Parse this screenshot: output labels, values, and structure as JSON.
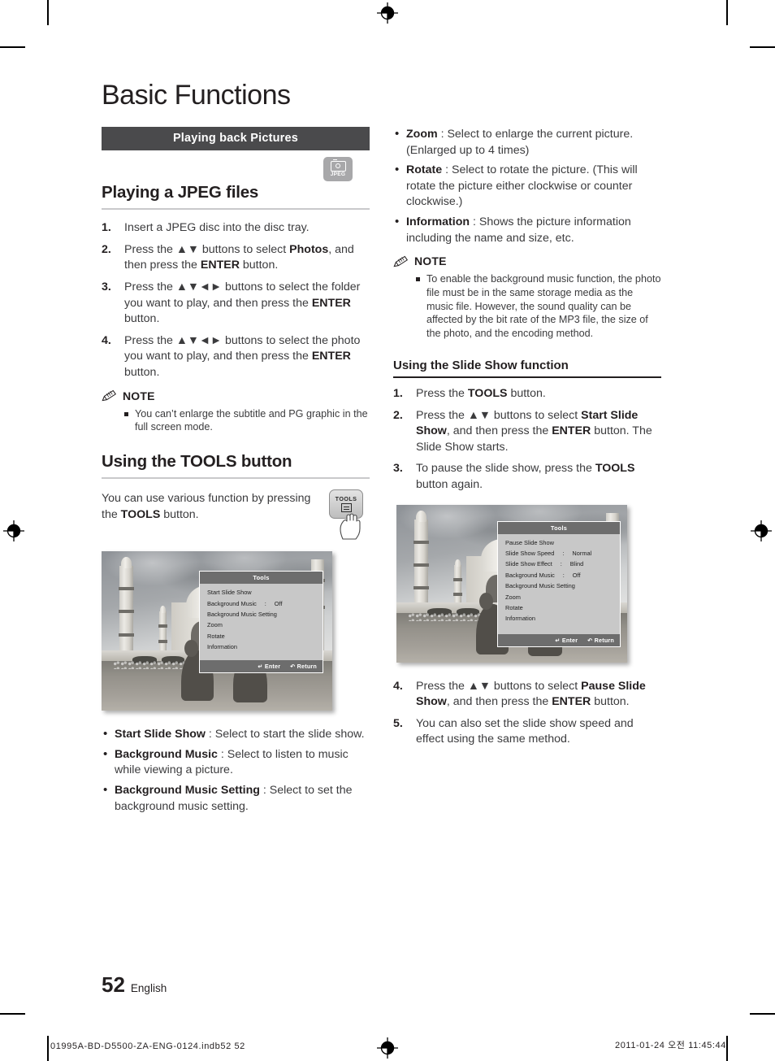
{
  "chapter": {
    "title": "Basic Functions"
  },
  "section_banner": {
    "label": "Playing back Pictures"
  },
  "media_badge": {
    "icon": "camera-icon",
    "label": "JPEG"
  },
  "left": {
    "heading": "Playing a JPEG files",
    "steps": [
      {
        "num": "1.",
        "text": "Insert a JPEG disc into the disc tray."
      },
      {
        "num": "2.",
        "text": "Press the ▲▼ buttons to select <b>Photos</b>, and then press the <b>ENTER</b> button."
      },
      {
        "num": "3.",
        "text": "Press the ▲▼◄► buttons to select the folder you want to play, and then press the <b>ENTER</b> button."
      },
      {
        "num": "4.",
        "text": "Press the ▲▼◄► buttons to select the photo you want to play, and then press the <b>ENTER</b> button."
      }
    ],
    "note": {
      "label": "NOTE",
      "items": [
        "You can’t enlarge the subtitle and PG graphic in the full screen mode."
      ]
    },
    "tools_heading": "Using the TOOLS button",
    "tools_paragraph": "You can use various function by pressing the <b>TOOLS</b> button.",
    "tools_key": {
      "label": "TOOLS",
      "icon": "tools-key-icon",
      "hand": "pointing-hand-icon"
    },
    "bullets": [
      {
        "term": "Start Slide Show",
        "desc": " : Select to start the slide show."
      },
      {
        "term": "Background Music",
        "desc": " : Select to listen to music while viewing a picture."
      },
      {
        "term": "Background Music Setting",
        "desc": " : Select to set the background music setting."
      }
    ]
  },
  "right": {
    "bullets": [
      {
        "term": "Zoom",
        "desc": " : Select to enlarge the current picture. (Enlarged up to 4 times)"
      },
      {
        "term": "Rotate",
        "desc": " : Select to rotate the picture. (This will rotate the picture either clockwise or counter clockwise.)"
      },
      {
        "term": "Information",
        "desc": " : Shows the picture information including the name and size, etc."
      }
    ],
    "note": {
      "label": "NOTE",
      "items": [
        "To enable the background music function, the photo file must be in the same storage media as the music file. However, the sound quality can be affected by the bit rate of the MP3 file, the size of the photo, and the encoding method."
      ]
    },
    "subheading": "Using the Slide Show function",
    "steps_top": [
      {
        "num": "1.",
        "text": "Press the <b>TOOLS</b> button."
      },
      {
        "num": "2.",
        "text": "Press the ▲▼ buttons to select <b>Start Slide Show</b>, and then press the <b>ENTER</b> button. The Slide Show starts."
      },
      {
        "num": "3.",
        "text": "To pause the slide show, press the <b>TOOLS</b> button again."
      }
    ],
    "steps_bottom": [
      {
        "num": "4.",
        "text": "Press the ▲▼ buttons to select <b>Pause Slide Show</b>, and then press the <b>ENTER</b> button."
      },
      {
        "num": "5.",
        "text": "You can also set the slide show speed and effect using the same method."
      }
    ]
  },
  "osd_left": {
    "title": "Tools",
    "items": [
      {
        "key": "Start Slide Show",
        "colon": "",
        "value": ""
      },
      {
        "key": "Background Music",
        "colon": ":",
        "value": "Off"
      },
      {
        "key": "Background Music Setting",
        "colon": "",
        "value": ""
      },
      {
        "key": "Zoom",
        "colon": "",
        "value": ""
      },
      {
        "key": "Rotate",
        "colon": "",
        "value": ""
      },
      {
        "key": "Information",
        "colon": "",
        "value": ""
      }
    ],
    "footer": {
      "enter": "Enter",
      "return": "Return"
    }
  },
  "osd_right": {
    "title": "Tools",
    "items": [
      {
        "key": "Pause Slide Show",
        "colon": "",
        "value": ""
      },
      {
        "key": "Slide Show Speed",
        "colon": ":",
        "value": "Normal"
      },
      {
        "key": "Slide Show Effect",
        "colon": ":",
        "value": "Blind"
      },
      {
        "key": "Background Music",
        "colon": ":",
        "value": "Off"
      },
      {
        "key": "Background Music Setting",
        "colon": "",
        "value": ""
      },
      {
        "key": "Zoom",
        "colon": "",
        "value": ""
      },
      {
        "key": "Rotate",
        "colon": "",
        "value": ""
      },
      {
        "key": "Information",
        "colon": "",
        "value": ""
      }
    ],
    "footer": {
      "enter": "Enter",
      "return": "Return"
    }
  },
  "footer": {
    "page_number": "52",
    "language": "English",
    "imprint_left": "01995A-BD-D5500-ZA-ENG-0124.indb52   52",
    "imprint_right": "2011-01-24   오전 11:45:44"
  },
  "colors": {
    "banner_bg": "#4a4a4c",
    "text": "#231f20",
    "body_text": "#3b3b3d",
    "rule_light": "#c9c9cb",
    "badge_gray": "#a8a8aa",
    "osd_bg": "#c8c8c8",
    "osd_bar": "#6d6d6d"
  }
}
